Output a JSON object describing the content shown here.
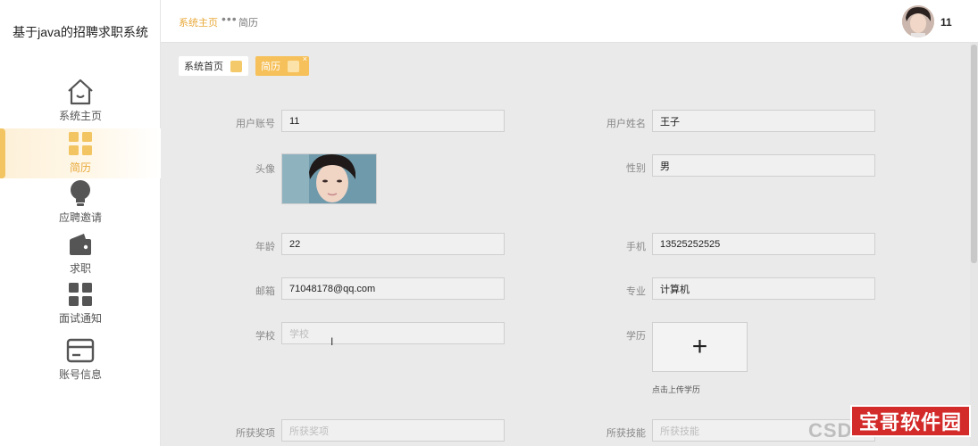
{
  "app": {
    "title": "基于java的招聘求职系统"
  },
  "sidebar": {
    "items": [
      {
        "label": "系统主页",
        "icon": "home-icon"
      },
      {
        "label": "简历",
        "icon": "grid-icon",
        "active": true
      },
      {
        "label": "应聘邀请",
        "icon": "bulb-icon"
      },
      {
        "label": "求职",
        "icon": "wallet-icon"
      },
      {
        "label": "面试通知",
        "icon": "grid-icon"
      },
      {
        "label": "账号信息",
        "icon": "card-icon"
      }
    ]
  },
  "header": {
    "breadcrumb_home": "系统主页",
    "breadcrumb_sep": "•••",
    "breadcrumb_current": "简历",
    "username": "11"
  },
  "tabs": [
    {
      "label": "系统首页"
    },
    {
      "label": "简历",
      "close": "×"
    }
  ],
  "form": {
    "account": {
      "label": "用户账号",
      "value": "11"
    },
    "name": {
      "label": "用户姓名",
      "value": "王子"
    },
    "avatar": {
      "label": "头像"
    },
    "gender": {
      "label": "性别",
      "value": "男"
    },
    "age": {
      "label": "年龄",
      "value": "22"
    },
    "phone": {
      "label": "手机",
      "value": "13525252525"
    },
    "email": {
      "label": "邮箱",
      "value": "71048178@qq.com"
    },
    "major": {
      "label": "专业",
      "value": "计算机"
    },
    "school": {
      "label": "学校",
      "placeholder": "学校"
    },
    "education": {
      "label": "学历",
      "upload_symbol": "+",
      "upload_hint": "点击上传学历"
    },
    "awards": {
      "label": "所获奖项",
      "placeholder": "所获奖项"
    },
    "skills": {
      "label": "所获技能",
      "placeholder": "所获技能"
    }
  },
  "watermark": {
    "csdn": "CSDN",
    "badge": "宝哥软件园"
  },
  "colors": {
    "accent": "#f6c15b",
    "active_text": "#e8a93a",
    "watermark_red": "#d32a2a"
  }
}
